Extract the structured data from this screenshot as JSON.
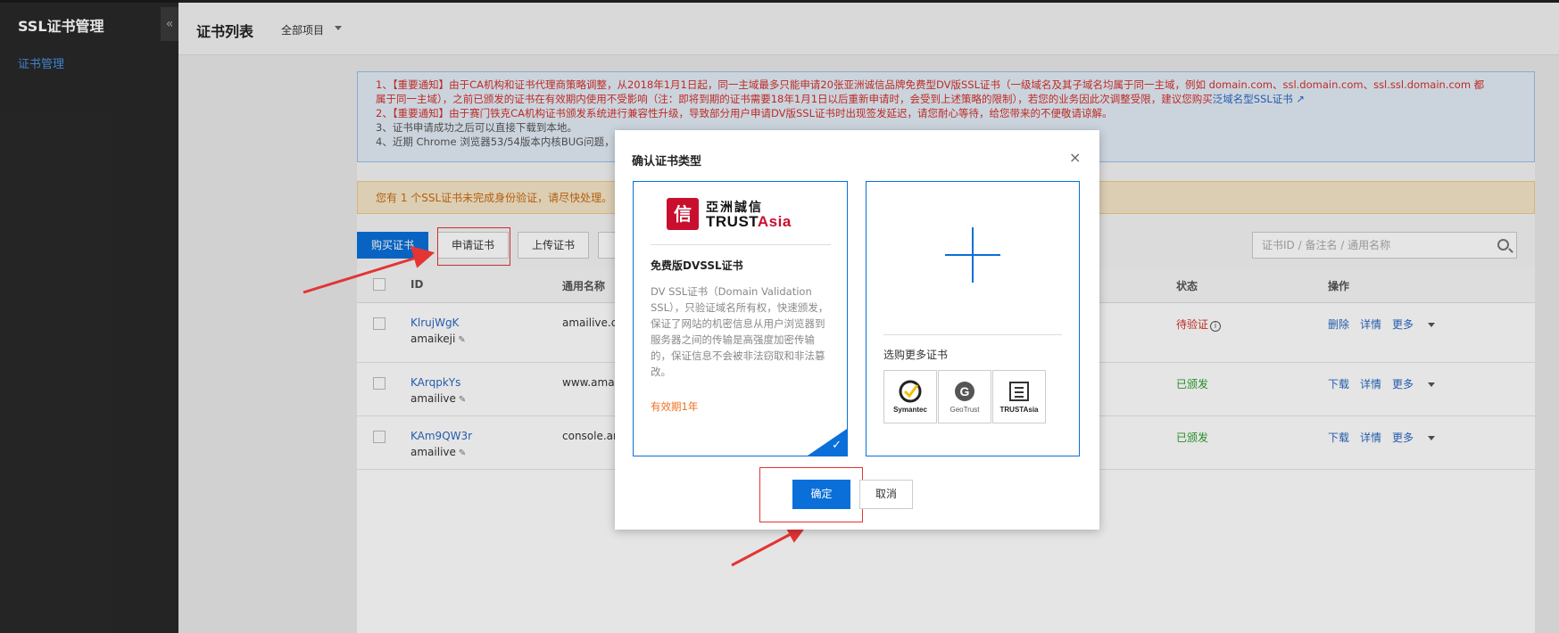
{
  "sidebar": {
    "title": "SSL证书管理",
    "collapse_icon": "«",
    "items": [
      {
        "label": "证书管理"
      }
    ]
  },
  "header": {
    "title": "证书列表",
    "project": "全部项目"
  },
  "notices": {
    "line1": "1、【重要通知】由于CA机构和证书代理商策略调整，从2018年1月1日起，同一主域最多只能申请20张亚洲诚信品牌免费型DV版SSL证书（一级域名及其子域名均属于同一主域，例如 domain.com、ssl.domain.com、ssl.ssl.domain.com 都",
    "line1b_prefix": "属于同一主域），之前已颁发的证书在有效期内使用不受影响（注：即将到期的证书需要18年1月1日以后重新申请时，会受到上述策略的限制），若您的业务因此次调整受限，建议您购买",
    "line1b_link": "泛域名型SSL证书",
    "line2": "2、【重要通知】由于赛门铁克CA机构证书颁发系统进行兼容性升级，导致部分用户申请DV版SSL证书时出现签发延迟，请您耐心等待，给您带来的不便敬请谅解。",
    "line3": "3、证书申请成功之后可以直接下载到本地。",
    "line4": "4、近期 Chrome 浏览器53/54版本内核BUG问题，",
    "orange": "您有 1 个SSL证书未完成身份验证，请尽快处理。"
  },
  "toolbar": {
    "buy": "购买证书",
    "apply": "申请证书",
    "upload": "上传证书",
    "search_placeholder": "证书ID / 备注名 / 通用名称"
  },
  "table": {
    "headers": {
      "id": "ID",
      "name": "通用名称",
      "status": "状态",
      "ops": "操作"
    },
    "rows": [
      {
        "id": "KlrujWgK",
        "remark": "amaikeji",
        "name": "amailive.co",
        "status": "待验证",
        "ops": [
          "删除",
          "详情",
          "更多"
        ]
      },
      {
        "id": "KArqpkYs",
        "remark": "amailive",
        "name": "www.amail",
        "status": "已颁发",
        "ops": [
          "下载",
          "详情",
          "更多"
        ]
      },
      {
        "id": "KAm9QW3r",
        "remark": "amailive",
        "name": "console.am",
        "status": "已颁发",
        "ops": [
          "下载",
          "详情",
          "更多"
        ]
      }
    ]
  },
  "modal": {
    "title": "确认证书类型",
    "close": "×",
    "left_card": {
      "logo_mark": "信",
      "logo_cn": "亞洲誠信",
      "logo_en_a": "TRUST",
      "logo_en_b": "Asia",
      "name": "免费版DVSSL证书",
      "desc": "DV SSL证书（Domain Validation SSL），只验证域名所有权，快速颁发，保证了网站的机密信息从用户浏览器到服务器之间的传输是高强度加密传输的，保证信息不会被非法窃取和非法篡改。",
      "validity": "有效期1年",
      "check": "✓"
    },
    "right_card": {
      "more_label": "选购更多证书",
      "brands": [
        "Symantec",
        "GeoTrust",
        "TRUSTAsia"
      ]
    },
    "confirm": "确定",
    "cancel": "取消"
  },
  "colors": {
    "accent": "#0a6fd8",
    "highlight": "#e43434",
    "sidebar_bg": "#292929"
  }
}
